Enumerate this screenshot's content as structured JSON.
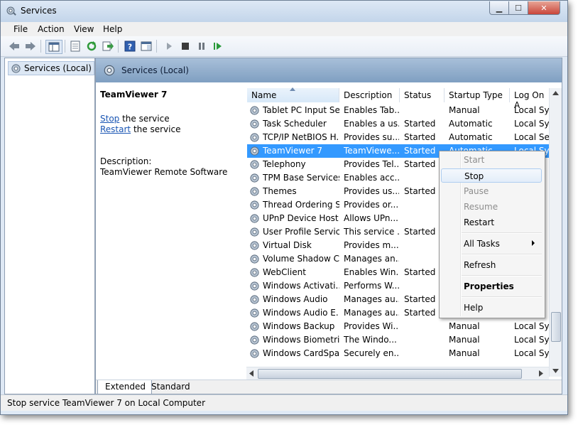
{
  "window": {
    "title": "Services"
  },
  "menubar": [
    "File",
    "Action",
    "View",
    "Help"
  ],
  "tree": {
    "root_label": "Services (Local)"
  },
  "header": {
    "title": "Services (Local)"
  },
  "details": {
    "service_name": "TeamViewer 7",
    "stop_link": "Stop",
    "stop_suffix": " the service",
    "restart_link": "Restart",
    "restart_suffix": " the service",
    "description_label": "Description:",
    "description_text": "TeamViewer Remote Software"
  },
  "columns": [
    "Name",
    "Description",
    "Status",
    "Startup Type",
    "Log On A"
  ],
  "rows": [
    {
      "name": "Tablet PC Input Se...",
      "desc": "Enables Tab...",
      "status": "",
      "startup": "Manual",
      "logon": "Local Syst"
    },
    {
      "name": "Task Scheduler",
      "desc": "Enables a us...",
      "status": "Started",
      "startup": "Automatic",
      "logon": "Local Syst"
    },
    {
      "name": "TCP/IP NetBIOS H...",
      "desc": "Provides su...",
      "status": "Started",
      "startup": "Automatic",
      "logon": "Local Serv"
    },
    {
      "name": "TeamViewer 7",
      "desc": "TeamViewe...",
      "status": "Started",
      "startup": "Automatic",
      "logon": "Local Syst",
      "selected": true
    },
    {
      "name": "Telephony",
      "desc": "Provides Tel...",
      "status": "Started",
      "startup": "",
      "logon": ""
    },
    {
      "name": "TPM Base Services",
      "desc": "Enables acc...",
      "status": "",
      "startup": "",
      "logon": ""
    },
    {
      "name": "Themes",
      "desc": "Provides us...",
      "status": "Started",
      "startup": "",
      "logon": ""
    },
    {
      "name": "Thread Ordering S...",
      "desc": "Provides or...",
      "status": "",
      "startup": "",
      "logon": ""
    },
    {
      "name": "UPnP Device Host",
      "desc": "Allows UPn...",
      "status": "",
      "startup": "",
      "logon": ""
    },
    {
      "name": "User Profile Service",
      "desc": "This service ...",
      "status": "Started",
      "startup": "",
      "logon": ""
    },
    {
      "name": "Virtual Disk",
      "desc": "Provides m...",
      "status": "",
      "startup": "",
      "logon": ""
    },
    {
      "name": "Volume Shadow C...",
      "desc": "Manages an...",
      "status": "",
      "startup": "",
      "logon": ""
    },
    {
      "name": "WebClient",
      "desc": "Enables Win...",
      "status": "Started",
      "startup": "",
      "logon": ""
    },
    {
      "name": "Windows Activati...",
      "desc": "Performs W...",
      "status": "",
      "startup": "",
      "logon": ""
    },
    {
      "name": "Windows Audio",
      "desc": "Manages au...",
      "status": "Started",
      "startup": "",
      "logon": ""
    },
    {
      "name": "Windows Audio E...",
      "desc": "Manages au...",
      "status": "Started",
      "startup": "",
      "logon": ""
    },
    {
      "name": "Windows Backup",
      "desc": "Provides Wi...",
      "status": "",
      "startup": "Manual",
      "logon": "Local Syst"
    },
    {
      "name": "Windows Biometri...",
      "desc": "The Windo...",
      "status": "",
      "startup": "Manual",
      "logon": "Local Syst"
    },
    {
      "name": "Windows CardSpa...",
      "desc": "Securely en...",
      "status": "",
      "startup": "Manual",
      "logon": "Local Syst"
    }
  ],
  "tabs": [
    "Extended",
    "Standard"
  ],
  "status_text": "Stop service TeamViewer 7 on Local Computer",
  "context_menu": {
    "start": "Start",
    "stop": "Stop",
    "pause": "Pause",
    "resume": "Resume",
    "restart": "Restart",
    "all_tasks": "All Tasks",
    "refresh": "Refresh",
    "properties": "Properties",
    "help": "Help"
  },
  "icons": [
    "back-icon",
    "forward-icon",
    "console-tree-icon",
    "properties-icon",
    "refresh-icon",
    "export-icon",
    "help-icon",
    "show-hide-icon",
    "start-icon",
    "stop-icon",
    "pause-icon",
    "resume-icon"
  ],
  "colors": {
    "selection": "#3399ff",
    "header_band": "#8fabcd",
    "link": "#1a56b4"
  }
}
